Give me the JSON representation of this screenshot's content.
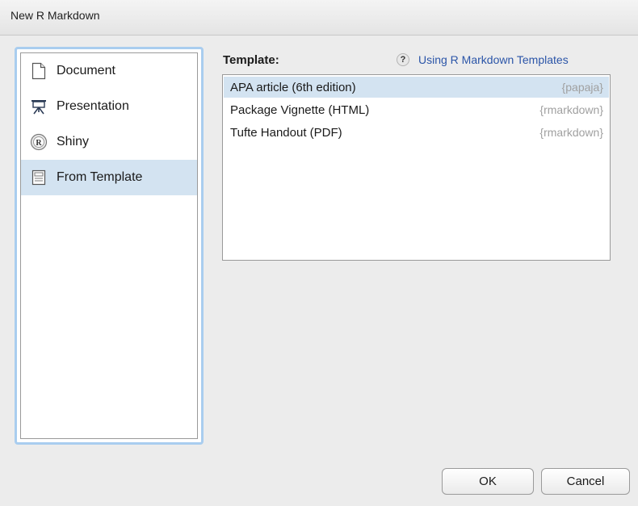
{
  "window": {
    "title": "New R Markdown"
  },
  "sidebar": {
    "items": [
      {
        "label": "Document",
        "icon": "document-icon",
        "selected": false
      },
      {
        "label": "Presentation",
        "icon": "presentation-icon",
        "selected": false
      },
      {
        "label": "Shiny",
        "icon": "shiny-icon",
        "selected": false
      },
      {
        "label": "From Template",
        "icon": "template-icon",
        "selected": true
      }
    ]
  },
  "main": {
    "template_label": "Template:",
    "help_link": {
      "icon": "question-icon",
      "icon_glyph": "?",
      "text": "Using R Markdown Templates"
    },
    "templates": [
      {
        "name": "APA article (6th edition)",
        "package": "{papaja}",
        "selected": true
      },
      {
        "name": "Package Vignette (HTML)",
        "package": "{rmarkdown}",
        "selected": false
      },
      {
        "name": "Tufte Handout (PDF)",
        "package": "{rmarkdown}",
        "selected": false
      }
    ]
  },
  "buttons": {
    "ok": "OK",
    "cancel": "Cancel"
  },
  "colors": {
    "selection": "#d3e3f1",
    "focus_ring": "#a9cdef",
    "link": "#2b55a8",
    "package_text": "#a0a0a0"
  }
}
